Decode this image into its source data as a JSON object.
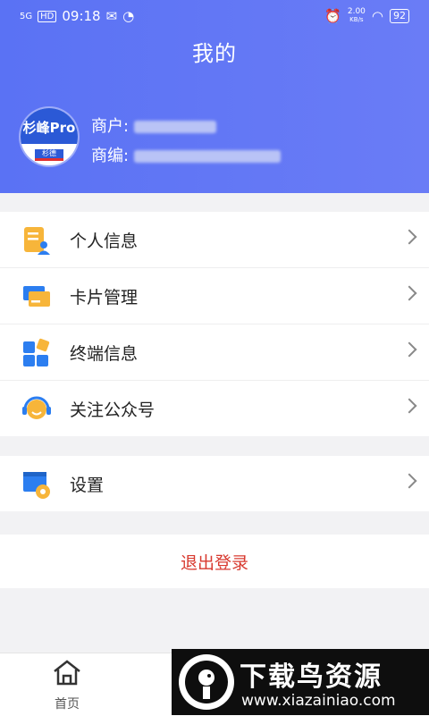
{
  "status_bar": {
    "signal": "5G",
    "hd": "HD",
    "time": "09:18",
    "net_speed_value": "2.00",
    "net_speed_unit": "KB/s",
    "battery": "92"
  },
  "header": {
    "title": "我的",
    "avatar_brand": "杉峰Pro",
    "avatar_sub": "杉德",
    "merchant_label": "商户:",
    "merchant_code_label": "商编:"
  },
  "menu_group1": {
    "items": [
      {
        "label": "个人信息",
        "icon": "profile-card-icon"
      },
      {
        "label": "卡片管理",
        "icon": "cards-icon"
      },
      {
        "label": "终端信息",
        "icon": "terminal-apps-icon"
      },
      {
        "label": "关注公众号",
        "icon": "headset-icon"
      }
    ]
  },
  "menu_group2": {
    "items": [
      {
        "label": "设置",
        "icon": "settings-window-icon"
      }
    ]
  },
  "logout": {
    "label": "退出登录"
  },
  "tabbar": {
    "home_label": "首页"
  },
  "watermark": {
    "title": "下载鸟资源",
    "url": "www.xiazainiao.com"
  },
  "colors": {
    "header": "#5f75f5",
    "logout": "#d83a30",
    "icon_orange": "#f7b53a",
    "icon_blue": "#2c7ef0"
  }
}
